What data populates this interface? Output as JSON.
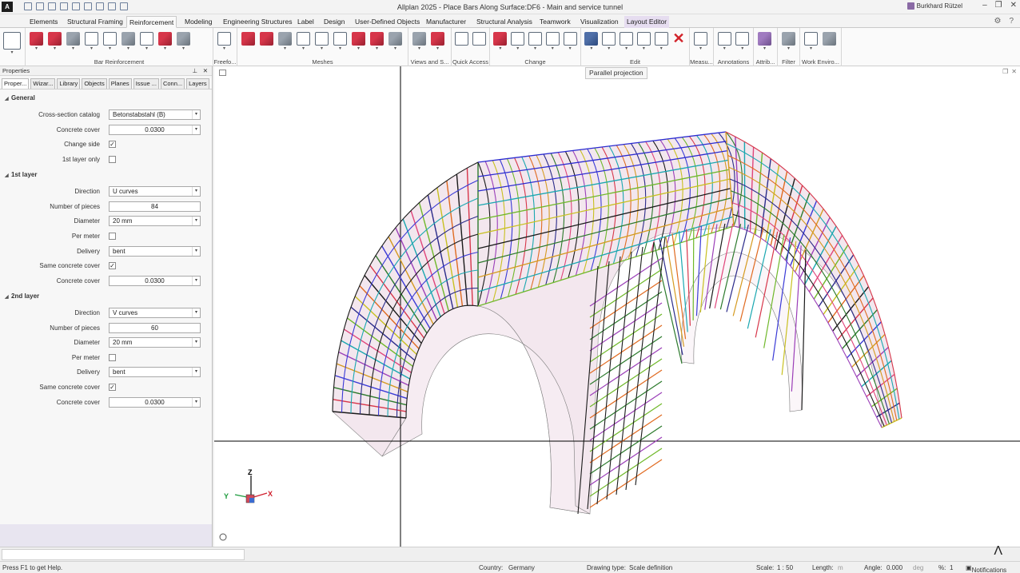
{
  "app": {
    "logo": "A",
    "window_title": "Allplan 2025 - Place Bars Along Surface:DF6 - Main and service tunnel",
    "user": "Burkhard Rützel"
  },
  "tabs": [
    {
      "label": "Elements"
    },
    {
      "label": "Structural Framing"
    },
    {
      "label": "Reinforcement",
      "active": true
    },
    {
      "label": "Modeling"
    },
    {
      "label": "Engineering Structures"
    },
    {
      "label": "Label"
    },
    {
      "label": "Design"
    },
    {
      "label": "User-Defined Objects"
    },
    {
      "label": "Manufacturer"
    },
    {
      "label": "Structural Analysis"
    },
    {
      "label": "Teamwork"
    },
    {
      "label": "Visualization"
    },
    {
      "label": "Layout Editor",
      "highlight": true
    }
  ],
  "ribbon": {
    "groups": [
      "Bar Reinforcement",
      "Freefo...",
      "Meshes",
      "Views and S...",
      "Quick Access",
      "Change",
      "Edit",
      "Measu...",
      "Annotations",
      "Attrib...",
      "Filter",
      "Work Enviro..."
    ]
  },
  "properties": {
    "title": "Properties",
    "tabs": [
      "Proper...",
      "Wizar...",
      "Library",
      "Objects",
      "Planes",
      "Issue ...",
      "Conn...",
      "Layers"
    ],
    "general": {
      "heading": "General",
      "cross_section_catalog_label": "Cross-section catalog",
      "cross_section_catalog_value": "Betonstabstahl (B)",
      "concrete_cover_label": "Concrete cover",
      "concrete_cover_value": "0.0300",
      "change_side_label": "Change side",
      "first_layer_only_label": "1st layer only"
    },
    "layer1": {
      "heading": "1st layer",
      "direction_label": "Direction",
      "direction_value": "U curves",
      "pieces_label": "Number of pieces",
      "pieces_value": "84",
      "diameter_label": "Diameter",
      "diameter_value": "20 mm",
      "per_meter_label": "Per meter",
      "delivery_label": "Delivery",
      "delivery_value": "bent",
      "same_cover_label": "Same concrete cover",
      "cover_label": "Concrete cover",
      "cover_value": "0.0300"
    },
    "layer2": {
      "heading": "2nd layer",
      "direction_label": "Direction",
      "direction_value": "V curves",
      "pieces_label": "Number of pieces",
      "pieces_value": "60",
      "diameter_label": "Diameter",
      "diameter_value": "20 mm",
      "per_meter_label": "Per meter",
      "delivery_label": "Delivery",
      "delivery_value": "bent",
      "same_cover_label": "Same concrete cover",
      "cover_label": "Concrete cover",
      "cover_value": "0.0300"
    },
    "checks": {
      "change_side": true,
      "first_layer_only": false,
      "l1_per_meter": false,
      "l1_same_cover": true,
      "l2_per_meter": false,
      "l2_same_cover": true
    }
  },
  "viewport": {
    "tooltip": "Parallel projection",
    "axes": {
      "z": "Z",
      "y": "Y",
      "x": "X"
    }
  },
  "status": {
    "help": "Press F1 to get Help.",
    "country_label": "Country:",
    "country_value": "Germany",
    "drawing_type_label": "Drawing type:",
    "drawing_type_value": "Scale definition",
    "scale_label": "Scale:",
    "scale_value": "1 : 50",
    "length_label": "Length:",
    "length_unit": "m",
    "angle_label": "Angle:",
    "angle_value": "0.000",
    "angle_unit": "deg",
    "percent_label": "%:",
    "percent_value": "1",
    "notifications": "Notifications"
  },
  "colors": {
    "accent": "#6e4f8c",
    "reinforcement_red": "#d7364a",
    "crosshair": "#000000"
  }
}
